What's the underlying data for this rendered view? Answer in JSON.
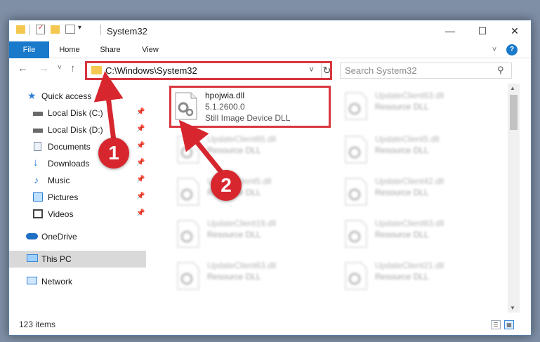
{
  "window": {
    "title": "System32",
    "controls": {
      "minimize": "—",
      "maximize": "☐",
      "close": "✕"
    }
  },
  "quick_access_toolbar": {
    "customize": "▾"
  },
  "ribbon": {
    "tabs": [
      {
        "label": "File"
      },
      {
        "label": "Home"
      },
      {
        "label": "Share"
      },
      {
        "label": "View"
      }
    ],
    "expand": "˅",
    "help": "?"
  },
  "navigation": {
    "back": "←",
    "forward": "→",
    "recent": "˅",
    "up": "↑",
    "address": "C:\\Windows\\System32",
    "search_placeholder": "Search System32"
  },
  "sidebar": {
    "items": [
      {
        "label": "Quick access",
        "icon": "star-icon",
        "color": "#2f7fd6"
      },
      {
        "label": "Local Disk (C:)",
        "icon": "drive-icon",
        "pinned": true,
        "color": "#6a6a6a"
      },
      {
        "label": "Local Disk (D:)",
        "icon": "drive-icon",
        "pinned": true,
        "color": "#6a6a6a"
      },
      {
        "label": "Documents",
        "icon": "documents-icon",
        "pinned": true,
        "color": "#7b8ea8"
      },
      {
        "label": "Downloads",
        "icon": "downloads-icon",
        "pinned": true,
        "color": "#2f7fd6"
      },
      {
        "label": "Music",
        "icon": "music-icon",
        "pinned": true,
        "color": "#2f7fd6"
      },
      {
        "label": "Pictures",
        "icon": "pictures-icon",
        "pinned": true,
        "color": "#2f7fd6"
      },
      {
        "label": "Videos",
        "icon": "videos-icon",
        "pinned": true,
        "color": "#444444"
      },
      {
        "label": "OneDrive",
        "icon": "onedrive-icon",
        "color": "#1f6fc5"
      },
      {
        "label": "This PC",
        "icon": "computer-icon",
        "selected": true,
        "color": "#3e8ad6"
      },
      {
        "label": "Network",
        "icon": "network-icon",
        "color": "#2f7fd6"
      }
    ]
  },
  "files": {
    "selected": {
      "name": "hpojwia.dll",
      "version": "5.1.2600.0",
      "description": "Still Image Device DLL"
    },
    "blurred": [
      {
        "name": "UpdateClient63.dll",
        "description": "Resource DLL"
      },
      {
        "name": "UpdateClient5.dll",
        "description": "Resource DLL"
      },
      {
        "name": "UpdateClient65.dll",
        "description": "Resource DLL"
      },
      {
        "name": "UpdateClient5.dll",
        "description": "Resource DLL"
      },
      {
        "name": "UpdateClient42.dll",
        "description": "Resource DLL"
      },
      {
        "name": "UpdateClient19.dll",
        "description": "Resource DLL"
      },
      {
        "name": "UpdateClient63.dll",
        "description": "Resource DLL"
      },
      {
        "name": "UpdateClient63.dll",
        "description": "Resource DLL"
      },
      {
        "name": "UpdateClient21.dll",
        "description": "Resource DLL"
      }
    ]
  },
  "status": {
    "item_count": "123 items"
  },
  "annotations": {
    "step1": "1",
    "step2": "2",
    "color": "#d7262e"
  }
}
